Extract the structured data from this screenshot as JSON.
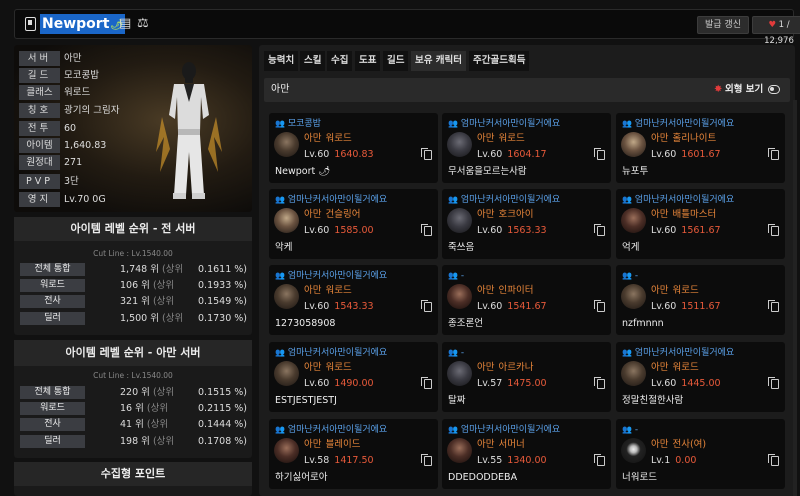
{
  "header": {
    "name": "Newport",
    "leaf_icon": "🌶",
    "id_icon": "▤",
    "scale_icon": "⚖",
    "refresh_label": "발급 갱신",
    "heart_icon": "♥",
    "likes": "1 / 12,976"
  },
  "profile": {
    "rows": [
      {
        "k": "서버",
        "v": "아만"
      },
      {
        "k": "길드",
        "v": "모코콩밥"
      },
      {
        "k": "클래스",
        "v": "워로드"
      },
      {
        "k": "칭호",
        "v": "광기의 그림자"
      },
      {
        "k": "전투",
        "v": "60"
      },
      {
        "k": "아이템",
        "v": "1,640.83"
      },
      {
        "k": "원정대",
        "v": "271"
      },
      {
        "k": "PVP",
        "v": "3단"
      },
      {
        "k": "영지",
        "v": "Lv.70 0G"
      }
    ]
  },
  "rank_all": {
    "title": "아이템 레벨 순위 - 전 서버",
    "cut": "Cut Line : Lv.1540.00",
    "rows": [
      {
        "k": "전체 통합",
        "v": "1,748 위",
        "s": "(상위",
        "p": "0.1611 %)"
      },
      {
        "k": "워로드",
        "v": "106 위",
        "s": "(상위",
        "p": "0.1933 %)"
      },
      {
        "k": "전사",
        "v": "321 위",
        "s": "(상위",
        "p": "0.1549 %)"
      },
      {
        "k": "딜러",
        "v": "1,500 위",
        "s": "(상위",
        "p": "0.1730 %)"
      }
    ]
  },
  "rank_server": {
    "title": "아이템 레벨 순위 - 아만 서버",
    "cut": "Cut Line : Lv.1540.00",
    "rows": [
      {
        "k": "전체 통합",
        "v": "220 위",
        "s": "(상위",
        "p": "0.1515 %)"
      },
      {
        "k": "워로드",
        "v": "16 위",
        "s": "(상위",
        "p": "0.2115 %)"
      },
      {
        "k": "전사",
        "v": "41 위",
        "s": "(상위",
        "p": "0.1444 %)"
      },
      {
        "k": "딜러",
        "v": "198 위",
        "s": "(상위",
        "p": "0.1708 %)"
      }
    ]
  },
  "collection": {
    "title": "수집형 포인트"
  },
  "tabs": [
    "능력치",
    "스킬",
    "수집",
    "도표",
    "길드",
    "보유 캐릭터",
    "주간골드획득"
  ],
  "server_bar": {
    "name": "아만",
    "sun_icon": "✸",
    "view_label": "외형 보기"
  },
  "cards": [
    {
      "guild": "모코콩밥",
      "server": "아만",
      "cls": "워로드",
      "lv": "Lv.60",
      "il": "1640.83",
      "name": "Newport 🌶"
    },
    {
      "guild": "엄마난커서아만이될거에요",
      "server": "아만",
      "cls": "워로드",
      "lv": "Lv.60",
      "il": "1604.17",
      "name": "무서움을모르는사람"
    },
    {
      "guild": "엄마난커서아만이될거에요",
      "server": "아만",
      "cls": "홀리나이트",
      "lv": "Lv.60",
      "il": "1601.67",
      "name": "뉴포투"
    },
    {
      "guild": "엄마난커서아만이될거에요",
      "server": "아만",
      "cls": "건슬링어",
      "lv": "Lv.60",
      "il": "1585.00",
      "name": "악케"
    },
    {
      "guild": "엄마난커서아만이될거에요",
      "server": "아만",
      "cls": "호크아이",
      "lv": "Lv.60",
      "il": "1563.33",
      "name": "죽쓰음"
    },
    {
      "guild": "엄마난커서아만이될거에요",
      "server": "아만",
      "cls": "배틀마스터",
      "lv": "Lv.60",
      "il": "1561.67",
      "name": "억게"
    },
    {
      "guild": "엄마난커서아만이될거에요",
      "server": "아만",
      "cls": "워로드",
      "lv": "Lv.60",
      "il": "1543.33",
      "name": "1273058908"
    },
    {
      "guild": "-",
      "server": "아만",
      "cls": "인파이터",
      "lv": "Lv.60",
      "il": "1541.67",
      "name": "종조론언"
    },
    {
      "guild": "-",
      "server": "아만",
      "cls": "워로드",
      "lv": "Lv.60",
      "il": "1511.67",
      "name": "nzfmnnn"
    },
    {
      "guild": "엄마난커서아만이될거에요",
      "server": "아만",
      "cls": "워로드",
      "lv": "Lv.60",
      "il": "1490.00",
      "name": "ESTJESTJESTJ"
    },
    {
      "guild": "-",
      "server": "아만",
      "cls": "아르카나",
      "lv": "Lv.57",
      "il": "1475.00",
      "name": "탈짜"
    },
    {
      "guild": "엄마난커서아만이될거에요",
      "server": "아만",
      "cls": "워로드",
      "lv": "Lv.60",
      "il": "1445.00",
      "name": "정말친절한사람"
    },
    {
      "guild": "엄마난커서아만이될거에요",
      "server": "아만",
      "cls": "블레이드",
      "lv": "Lv.58",
      "il": "1417.50",
      "name": "하기싫어로아"
    },
    {
      "guild": "엄마난커서아만이될거에요",
      "server": "아만",
      "cls": "서머너",
      "lv": "Lv.55",
      "il": "1340.00",
      "name": "DDEDODDEBA"
    },
    {
      "guild": "-",
      "server": "아만",
      "cls": "전사(여)",
      "lv": "Lv.1",
      "il": "0.00",
      "name": "너워로드"
    }
  ]
}
